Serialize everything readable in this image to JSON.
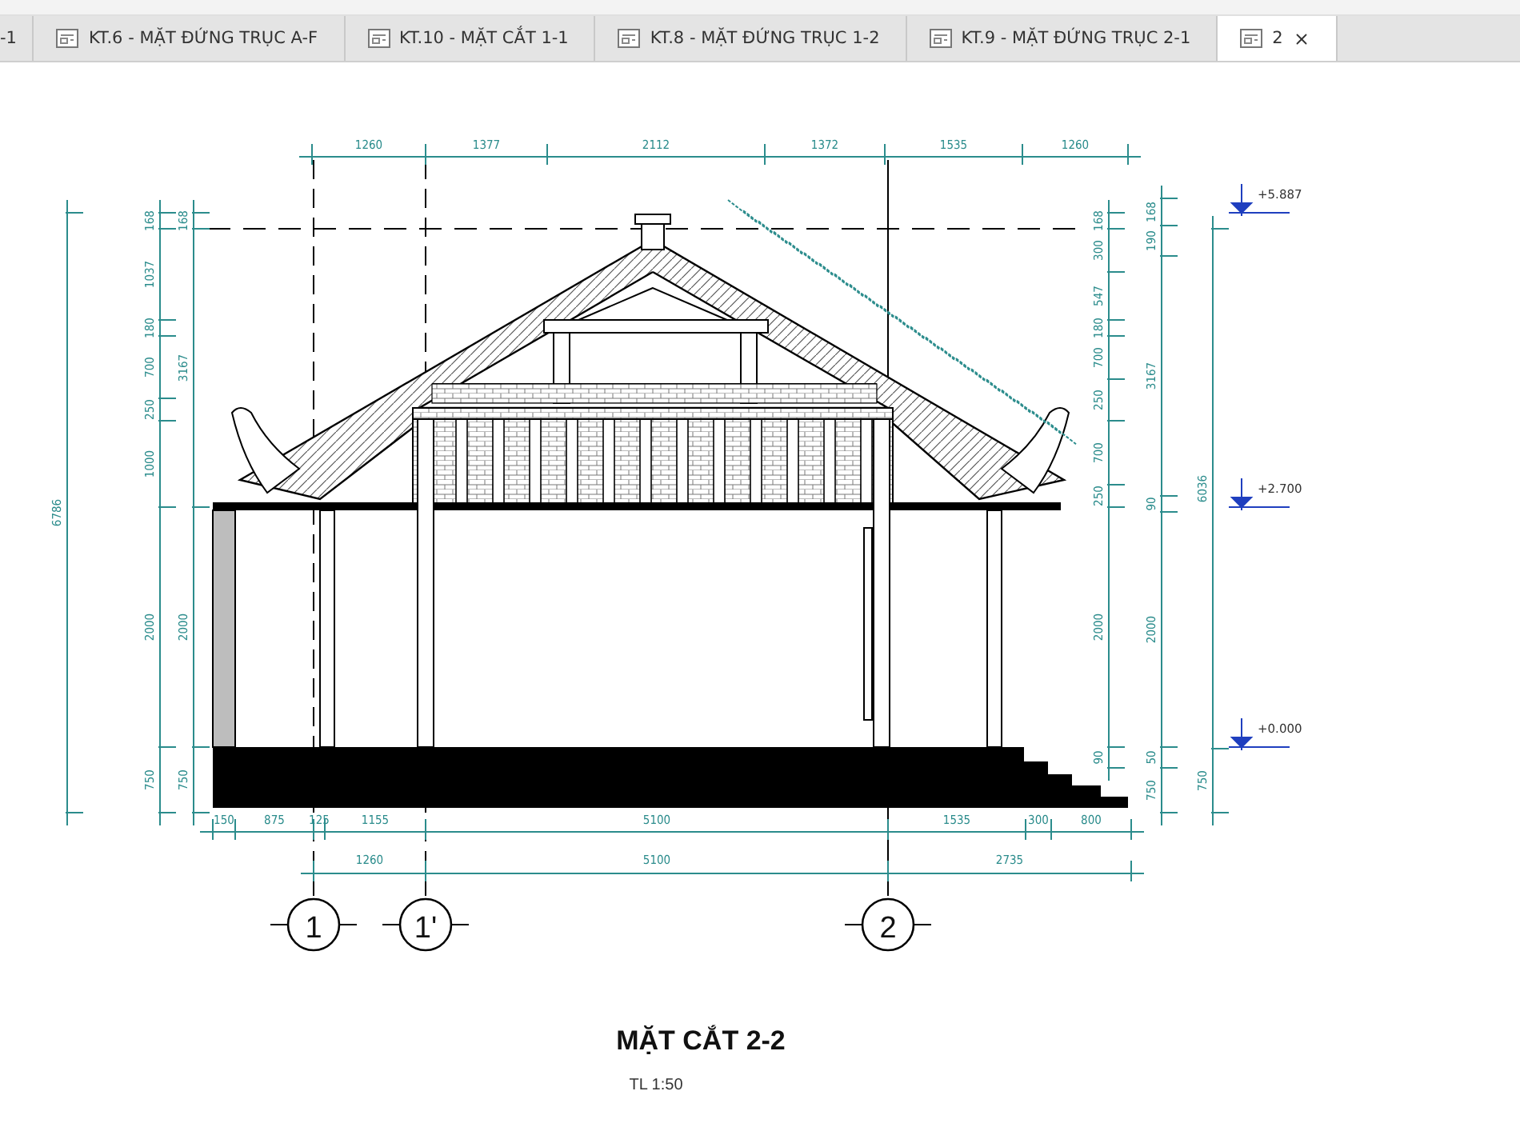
{
  "tabs": [
    {
      "label": "-1",
      "kind": "cut",
      "selected": false,
      "closable": false
    },
    {
      "label": "KT.6 - MẶT ĐỨNG TRỤC A-F",
      "kind": "sheet",
      "selected": false,
      "closable": false
    },
    {
      "label": "KT.10 - MẶT CẮT 1-1",
      "kind": "sheet",
      "selected": false,
      "closable": false
    },
    {
      "label": "KT.8 - MẶT ĐỨNG TRỤC 1-2",
      "kind": "sheet",
      "selected": false,
      "closable": false
    },
    {
      "label": "KT.9 - MẶT ĐỨNG TRỤC 2-1",
      "kind": "sheet",
      "selected": false,
      "closable": false
    },
    {
      "label": "2",
      "kind": "sheet",
      "selected": true,
      "closable": true
    }
  ],
  "section": {
    "top_dimensions": [
      "1260",
      "1377",
      "2112",
      "1372",
      "1535",
      "1260"
    ],
    "left_dimensions": [
      {
        "values": [
          "168",
          "1037",
          "180",
          "700",
          "250",
          "1000",
          "2000",
          "750"
        ]
      },
      {
        "values": [
          "168",
          "3167",
          "2000",
          "750"
        ]
      },
      {
        "values": [
          "6786"
        ]
      }
    ],
    "right_dimensions": [
      {
        "values": [
          "168",
          "300",
          "547",
          "180",
          "700",
          "250",
          "700",
          "250",
          "2000",
          "90"
        ]
      },
      {
        "values": [
          "168",
          "190",
          "3167",
          "90",
          "2000",
          "50",
          "750"
        ]
      },
      {
        "values": [
          "6036",
          "750"
        ]
      }
    ],
    "levels": [
      "+5.887",
      "+2.700",
      "+0.000"
    ],
    "bottom_dimensions": [
      {
        "values": [
          "150",
          "875",
          "125",
          "1155",
          "5100",
          "1535",
          "300",
          "800"
        ]
      },
      {
        "values": [
          "1260",
          "5100",
          "2735"
        ]
      }
    ],
    "grid_axes": [
      "1",
      "1'",
      "2"
    ],
    "title": "MẶT CẮT 2-2",
    "scale": "TL 1:50"
  }
}
